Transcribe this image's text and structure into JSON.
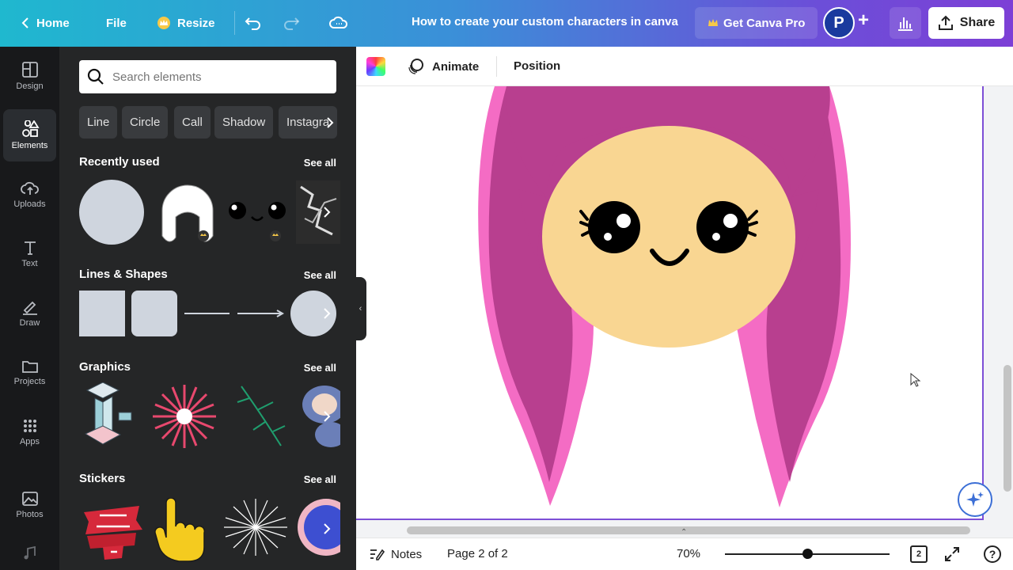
{
  "topbar": {
    "home_label": "Home",
    "file_label": "File",
    "resize_label": "Resize",
    "doc_title": "How to create your custom characters in canva",
    "pro_label": "Get Canva Pro",
    "avatar_letter": "P",
    "share_label": "Share"
  },
  "rail": {
    "items": [
      {
        "label": "Design"
      },
      {
        "label": "Elements"
      },
      {
        "label": "Uploads"
      },
      {
        "label": "Text"
      },
      {
        "label": "Draw"
      },
      {
        "label": "Projects"
      },
      {
        "label": "Apps"
      },
      {
        "label": "Photos"
      }
    ],
    "active": "Elements"
  },
  "panel": {
    "search_placeholder": "Search elements",
    "chips": [
      "Line",
      "Circle",
      "Call",
      "Shadow",
      "Instagra"
    ],
    "sections": [
      {
        "title": "Recently used",
        "see_all": "See all"
      },
      {
        "title": "Lines & Shapes",
        "see_all": "See all"
      },
      {
        "title": "Graphics",
        "see_all": "See all"
      },
      {
        "title": "Stickers",
        "see_all": "See all"
      }
    ]
  },
  "canvas_toolbar": {
    "animate_label": "Animate",
    "position_label": "Position"
  },
  "bottombar": {
    "notes_label": "Notes",
    "page_indicator": "Page 2 of 2",
    "zoom": "70%",
    "page_count": "2"
  },
  "colors": {
    "panel_bg": "#252627",
    "rail_bg": "#18191b",
    "hair_dark": "#b83f8f",
    "hair_light": "#f46cc4",
    "skin": "#f9d692",
    "selection": "#7d4fd6"
  }
}
